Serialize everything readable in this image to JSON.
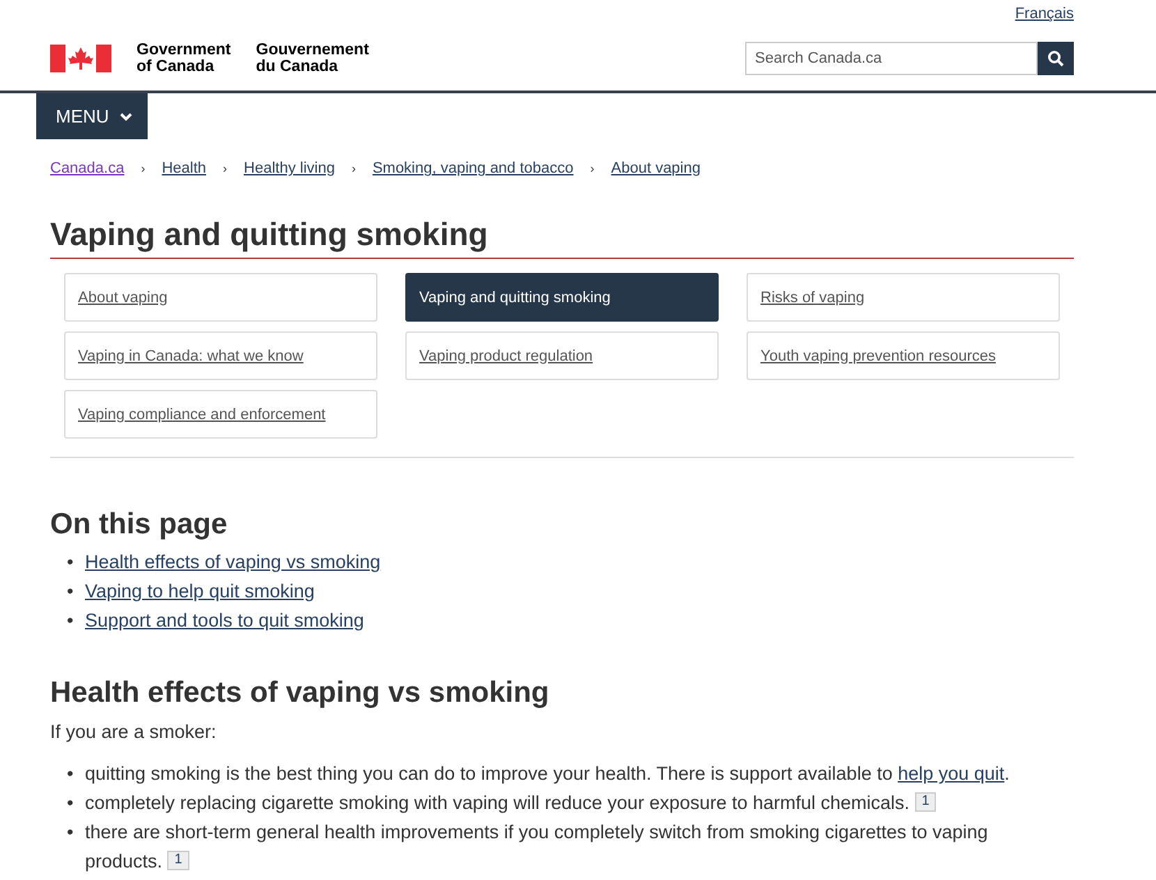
{
  "language_link": "Français",
  "wordmark": {
    "english": [
      "Government",
      "of Canada"
    ],
    "french": [
      "Gouvernement",
      "du Canada"
    ]
  },
  "search": {
    "placeholder": "Search Canada.ca"
  },
  "menu_button": {
    "label": "MENU"
  },
  "breadcrumbs": [
    {
      "label": "Canada.ca",
      "visited": true
    },
    {
      "separator": "›",
      "label": "Health",
      "visited": false
    },
    {
      "separator": "›",
      "label": "Healthy living",
      "visited": false
    },
    {
      "separator": "›",
      "label": "Smoking, vaping and tobacco",
      "visited": false
    },
    {
      "separator": "›",
      "label": "About vaping",
      "visited": false
    }
  ],
  "title": "Vaping and quitting smoking",
  "section_nav": [
    {
      "label": "About vaping",
      "selected": false
    },
    {
      "label": "Vaping and quitting smoking",
      "selected": true
    },
    {
      "label": "Risks of vaping",
      "selected": false
    },
    {
      "label": "Vaping in Canada: what we know",
      "selected": false
    },
    {
      "label": "Vaping product regulation",
      "selected": false
    },
    {
      "label": "Youth vaping prevention resources",
      "selected": false
    },
    {
      "label": "Vaping compliance and enforcement",
      "selected": false
    }
  ],
  "on_this_page": {
    "heading": "On this page",
    "links": [
      {
        "marker": "•",
        "label": "Health effects of vaping vs smoking"
      },
      {
        "marker": "•",
        "label": "Vaping to help quit smoking"
      },
      {
        "marker": "•",
        "label": "Support and tools to quit smoking"
      }
    ]
  },
  "section": {
    "heading": "Health effects of vaping vs smoking",
    "intro": "If you are a smoker:",
    "bullets": [
      {
        "marker": "•",
        "text": "quitting smoking is the best thing you can do to improve your health. There is support available to ",
        "link": "help you quit",
        "suffix": "."
      },
      {
        "marker": "•",
        "text": "completely replacing cigarette smoking with vaping will reduce your exposure to harmful chemicals. ",
        "footnote": "1"
      },
      {
        "marker": "•",
        "text": "there are short-term general health improvements if you completely switch from smoking cigarettes to vaping products. ",
        "footnote": "1"
      }
    ]
  }
}
